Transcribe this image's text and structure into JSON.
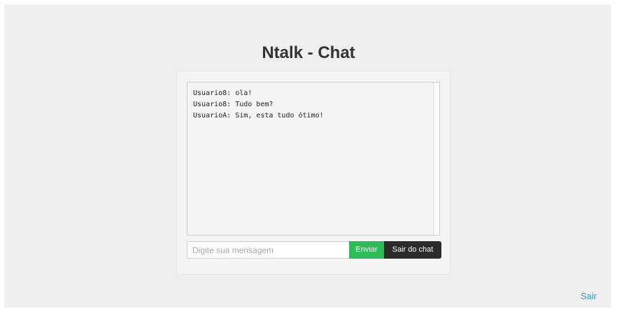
{
  "page": {
    "title": "Ntalk - Chat"
  },
  "chat": {
    "messages": [
      {
        "text": "Usuario8: ola!"
      },
      {
        "text": "Usuario8: Tudo bem?"
      },
      {
        "text": "UsuarioA: Sim, esta tudo ótimo!"
      }
    ]
  },
  "composer": {
    "placeholder": "Digite sua mensagem",
    "value": "",
    "send_label": "Enviar",
    "leave_label": "Sair do chat"
  },
  "footer": {
    "logout_label": "Sair"
  },
  "colors": {
    "send_button": "#2dbb5a",
    "leave_button": "#2b2b2b",
    "link": "#2a9fd6"
  }
}
